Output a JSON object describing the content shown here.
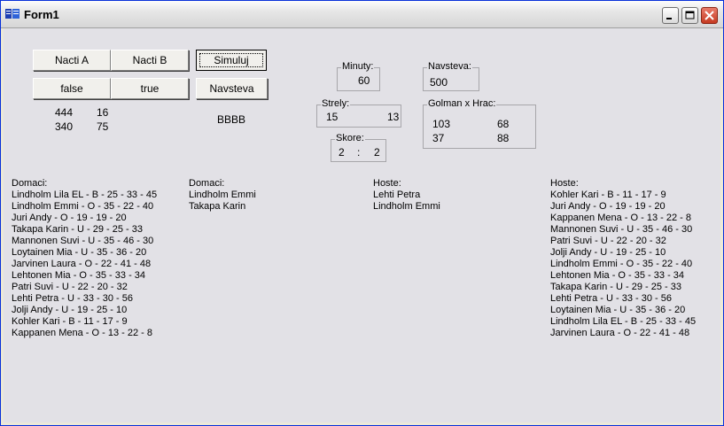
{
  "window": {
    "title": "Form1"
  },
  "buttons": {
    "nacti_a": "Nacti A",
    "nacti_b": "Nacti B",
    "simuluj": "Simuluj",
    "false_btn": "false",
    "true_btn": "true",
    "navsteva_btn": "Navsteva"
  },
  "numbers": {
    "r1c1": "444",
    "r1c2": "16",
    "r2c1": "340",
    "r2c2": "75"
  },
  "bbbb_label": "BBBB",
  "minuty": {
    "title": "Minuty:",
    "value": "60"
  },
  "navsteva": {
    "title": "Navsteva:",
    "value": "500"
  },
  "strely": {
    "title": "Strely:",
    "home": "15",
    "away": "13"
  },
  "golman": {
    "title": "Golman x Hrac:",
    "a1": "103",
    "a2": "68",
    "b1": "37",
    "b2": "88"
  },
  "skore": {
    "title": "Skore:",
    "home": "2",
    "sep": ":",
    "away": "2"
  },
  "lists": {
    "domaci_all": {
      "title": "Domaci:",
      "items": [
        "Lindholm Lila EL - B - 25 - 33 - 45",
        "Lindholm Emmi - O - 35 - 22 - 40",
        "Juri Andy - O - 19 - 19 - 20",
        "Takapa Karin - U - 29 - 25 - 33",
        "Mannonen Suvi - U - 35 - 46 - 30",
        "Loytainen Mia - U - 35 - 36 - 20",
        "Jarvinen Laura - O - 22 - 41 - 48",
        "Lehtonen Mia - O - 35 - 33 - 34",
        "Patri Suvi - U - 22 - 20 - 32",
        "Lehti Petra - U - 33 - 30 - 56",
        "Jolji Andy - U - 19 - 25 - 10",
        "Kohler Kari - B - 11 - 17 - 9",
        "Kappanen Mena - O - 13 - 22 - 8"
      ]
    },
    "domaci_sel": {
      "title": "Domaci:",
      "items": [
        "Lindholm Emmi",
        "Takapa Karin"
      ]
    },
    "hoste_sel": {
      "title": "Hoste:",
      "items": [
        "Lehti Petra",
        "Lindholm Emmi"
      ]
    },
    "hoste_all": {
      "title": "Hoste:",
      "items": [
        "Kohler Kari - B - 11 - 17 - 9",
        "Juri Andy - O - 19 - 19 - 20",
        "Kappanen Mena - O - 13 - 22 - 8",
        "Mannonen Suvi - U - 35 - 46 - 30",
        "Patri Suvi - U - 22 - 20 - 32",
        "Jolji Andy - U - 19 - 25 - 10",
        "Lindholm Emmi - O - 35 - 22 - 40",
        "Lehtonen Mia - O - 35 - 33 - 34",
        "Takapa Karin - U - 29 - 25 - 33",
        "Lehti Petra - U - 33 - 30 - 56",
        "Loytainen Mia - U - 35 - 36 - 20",
        "Lindholm Lila EL - B - 25 - 33 - 45",
        "Jarvinen Laura - O - 22 - 41 - 48"
      ]
    }
  }
}
